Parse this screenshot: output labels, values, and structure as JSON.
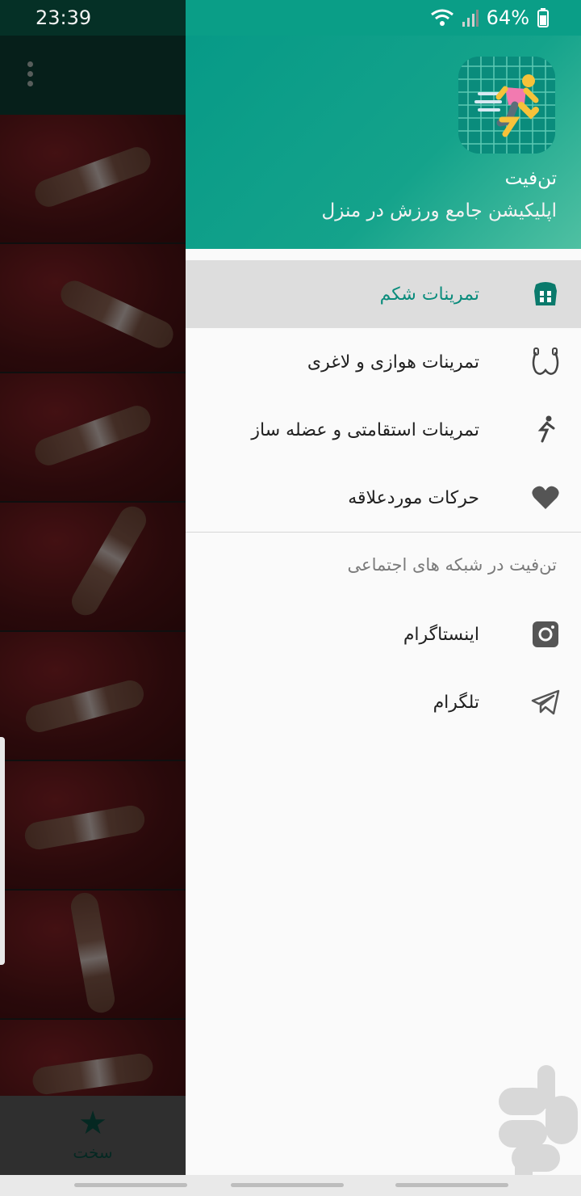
{
  "status_bar": {
    "time": "23:39",
    "battery": "64%"
  },
  "background_app": {
    "bottom_nav_label": "سخت",
    "thumbnails": [
      "exercise-1",
      "exercise-2",
      "exercise-3",
      "exercise-4",
      "exercise-5",
      "exercise-6",
      "exercise-7",
      "exercise-8"
    ]
  },
  "drawer": {
    "app_title": "تن‌فیت",
    "app_subtitle": "اپلیکیشن جامع ورزش در منزل",
    "menu": [
      {
        "label": "تمرینات شکم",
        "icon": "abs-icon",
        "selected": true
      },
      {
        "label": "تمرینات هوازی و لاغری",
        "icon": "jump-rope-icon",
        "selected": false
      },
      {
        "label": "تمرینات استقامتی و عضله ساز",
        "icon": "runner-bolt-icon",
        "selected": false
      },
      {
        "label": "حرکات موردعلاقه",
        "icon": "heart-icon",
        "selected": false
      }
    ],
    "social_section_title": "تن‌فیت در شبکه های اجتماعی",
    "social": [
      {
        "label": "اینستاگرام",
        "icon": "instagram-icon"
      },
      {
        "label": "تلگرام",
        "icon": "telegram-icon"
      }
    ]
  },
  "colors": {
    "accent": "#0a8c7c",
    "header_start": "#079a87",
    "header_end": "#4fc0a2"
  }
}
